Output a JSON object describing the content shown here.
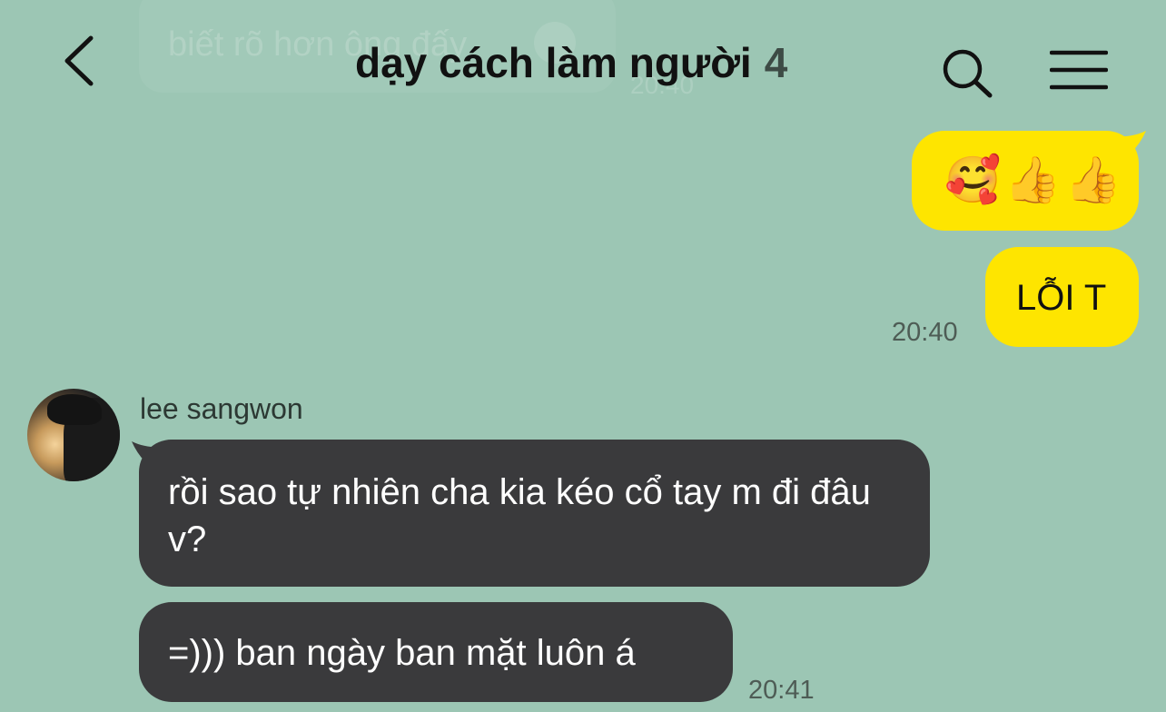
{
  "header": {
    "title": "dạy cách làm người",
    "member_count": "4",
    "back_icon": "chevron-left-icon",
    "search_icon": "search-icon",
    "menu_icon": "hamburger-menu-icon"
  },
  "background_previous_message": {
    "text": "biết rõ hơn ông đấy",
    "time": "20:40"
  },
  "messages": [
    {
      "from": "me",
      "text": "🥰👍👍",
      "bubble_color": "#fee500"
    },
    {
      "from": "me",
      "text": "LỖI T",
      "time": "20:40",
      "bubble_color": "#fee500"
    },
    {
      "from": "lee sangwon",
      "text": "rồi sao tự nhiên cha kia kéo cổ tay m đi đâu v?",
      "bubble_color": "#3a3a3c"
    },
    {
      "from": "lee sangwon",
      "text": "=))) ban ngày ban mặt luôn á",
      "time": "20:41",
      "bubble_color": "#3a3a3c"
    }
  ],
  "colors": {
    "background": "#9cc6b4",
    "my_bubble": "#fee500",
    "their_bubble": "#3a3a3c"
  }
}
